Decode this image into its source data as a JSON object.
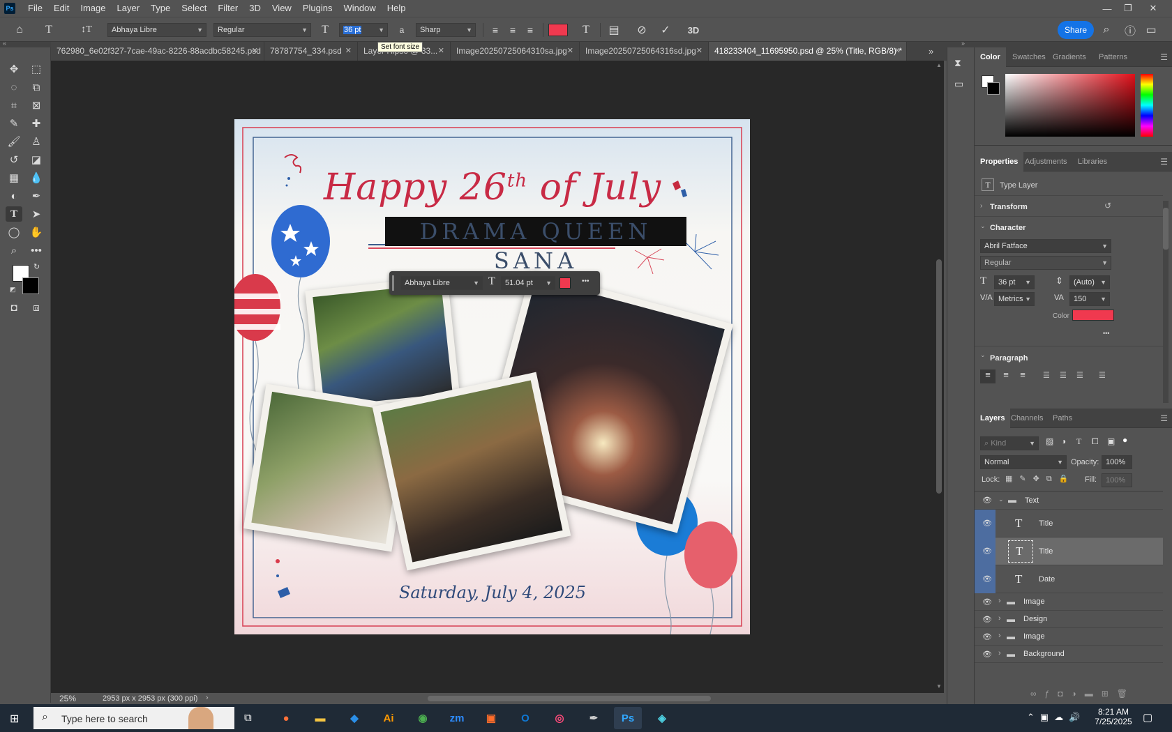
{
  "menu": [
    "File",
    "Edit",
    "Image",
    "Layer",
    "Type",
    "Select",
    "Filter",
    "3D",
    "View",
    "Plugins",
    "Window",
    "Help"
  ],
  "app_logo": "Ps",
  "window_controls": {
    "minimize": "—",
    "restore": "❐",
    "close": "✕"
  },
  "options": {
    "font_family": "Abhaya Libre",
    "font_style": "Regular",
    "font_size": "36 pt",
    "aa_label": "a",
    "antialias": "Sharp",
    "text_color": "#f0394f",
    "tooltip": "Set font size",
    "share_label": "Share",
    "3d_label": "3D"
  },
  "tabs": [
    {
      "label": "762980_6e02f327-7cae-49ac-8226-88acdbc58245.psd",
      "active": false
    },
    {
      "label": "78787754_334.psd",
      "active": false
    },
    {
      "label": "Layer Hipso @ 33...",
      "active": false
    },
    {
      "label": "Image20250725064310sa.jpg",
      "active": false
    },
    {
      "label": "Image20250725064316sd.jpg",
      "active": false
    },
    {
      "label": "418233404_11695950.psd @ 25% (Title, RGB/8) *",
      "active": true
    }
  ],
  "document": {
    "headline": "Happy 26",
    "headline_sup": "th",
    "headline_end": " of July",
    "name_text": "DRAMA QUEEN SANA",
    "date_text": "Saturday, July 4, 2025"
  },
  "ctxbar": {
    "font": "Abhaya Libre",
    "size": "51.04 pt",
    "more": "•••",
    "color": "#f0394f"
  },
  "status": {
    "zoom": "25%",
    "dimensions": "2953 px x 2953 px (300 ppi)"
  },
  "color_panel": {
    "tabs": [
      "Color",
      "Swatches",
      "Gradients",
      "Patterns"
    ],
    "base_hue": "#e0101a"
  },
  "properties": {
    "tabs": [
      "Properties",
      "Adjustments",
      "Libraries"
    ],
    "layer_type": "Type Layer",
    "transform_label": "Transform",
    "character_label": "Character",
    "font": "Abril Fatface",
    "style": "Regular",
    "size": "36 pt",
    "leading": "(Auto)",
    "kerning": "Metrics",
    "tracking": "150",
    "color_label": "Color",
    "color_value": "#f0394f",
    "paragraph_label": "Paragraph",
    "more": "•••"
  },
  "layers_panel": {
    "tabs": [
      "Layers",
      "Channels",
      "Paths"
    ],
    "kind_placeholder": "Kind",
    "blend_mode": "Normal",
    "opacity_label": "Opacity:",
    "opacity": "100%",
    "lock_label": "Lock:",
    "fill_label": "Fill:",
    "fill": "100%",
    "layers": [
      {
        "name": "Text",
        "kind": "group",
        "indent": 0,
        "expanded": true,
        "selected": false
      },
      {
        "name": "Title",
        "kind": "text",
        "indent": 1,
        "selected": false
      },
      {
        "name": "Title",
        "kind": "text",
        "indent": 1,
        "selected": true
      },
      {
        "name": "Date",
        "kind": "text",
        "indent": 1,
        "selected": false
      },
      {
        "name": "Image",
        "kind": "group",
        "indent": 0,
        "selected": false
      },
      {
        "name": "Design",
        "kind": "group",
        "indent": 0,
        "selected": false
      },
      {
        "name": "Image",
        "kind": "group",
        "indent": 0,
        "selected": false
      },
      {
        "name": "Background",
        "kind": "group",
        "indent": 0,
        "selected": false
      }
    ]
  },
  "taskbar": {
    "search_placeholder": "Type here to search",
    "time": "8:21 AM",
    "date": "7/25/2025",
    "apps": [
      {
        "name": "firefox",
        "glyph": "●",
        "color": "#ff7139"
      },
      {
        "name": "file-explorer",
        "glyph": "▬",
        "color": "#f5c542"
      },
      {
        "name": "vscode",
        "glyph": "◆",
        "color": "#2b8fe8"
      },
      {
        "name": "illustrator",
        "glyph": "Ai",
        "color": "#ff9a00"
      },
      {
        "name": "chrome",
        "glyph": "◉",
        "color": "#4caf50"
      },
      {
        "name": "zoom",
        "glyph": "zm",
        "color": "#2d8cff"
      },
      {
        "name": "app-orange",
        "glyph": "▣",
        "color": "#ff6d2a"
      },
      {
        "name": "outlook",
        "glyph": "O",
        "color": "#0f78d4"
      },
      {
        "name": "creative-cloud",
        "glyph": "◎",
        "color": "#ff4b7b"
      },
      {
        "name": "pen-tool",
        "glyph": "✒",
        "color": "#cfcfcf"
      },
      {
        "name": "photoshop",
        "glyph": "Ps",
        "color": "#31a8ff"
      },
      {
        "name": "app-teal",
        "glyph": "◈",
        "color": "#4dd0e1"
      }
    ]
  }
}
